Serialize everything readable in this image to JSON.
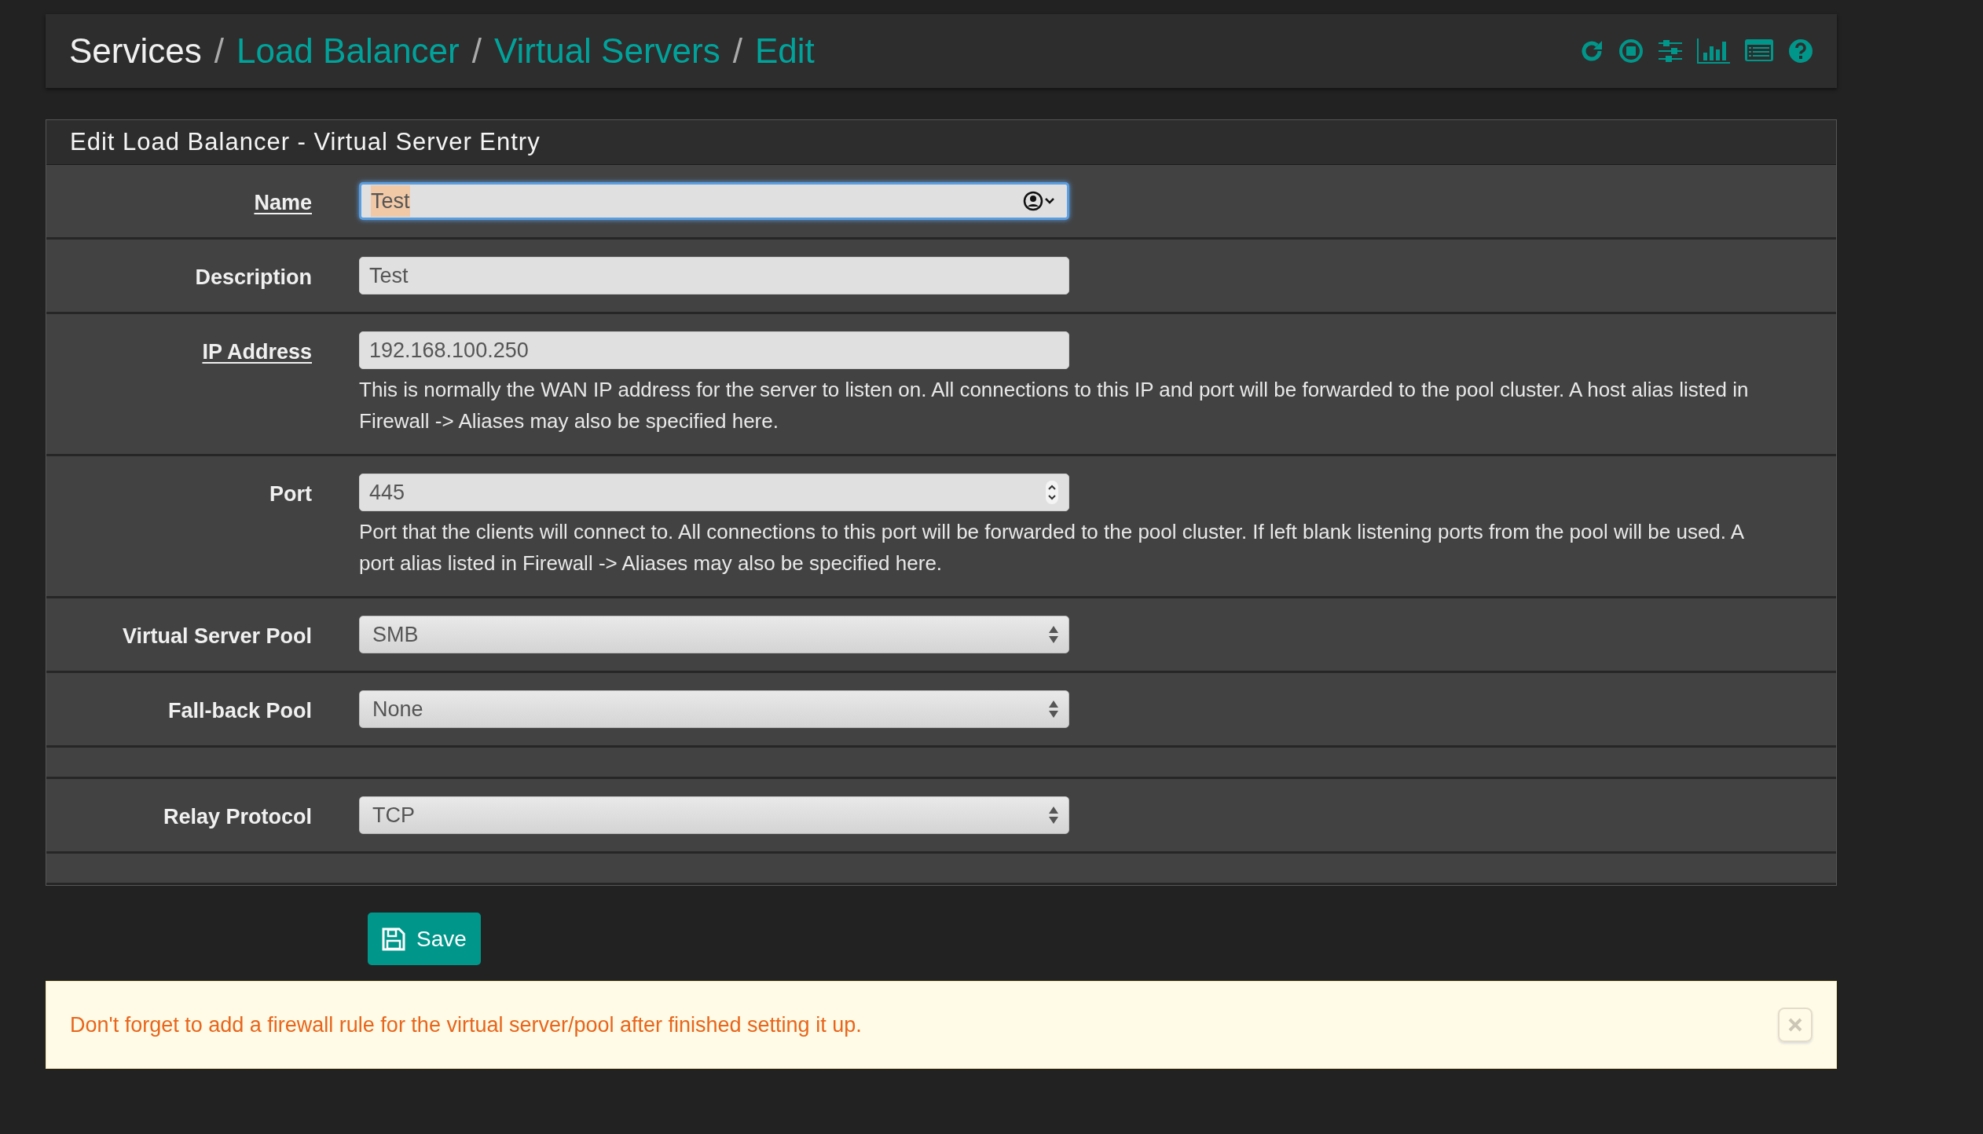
{
  "breadcrumb": [
    {
      "label": "Services",
      "kind": "plain",
      "separator": "/"
    },
    {
      "label": "Load Balancer",
      "kind": "link",
      "separator": "/"
    },
    {
      "label": "Virtual Servers",
      "kind": "link",
      "separator": "/"
    },
    {
      "label": "Edit",
      "kind": "link"
    }
  ],
  "panel": {
    "title": "Edit Load Balancer - Virtual Server Entry",
    "rows": [
      {
        "kind": "text",
        "label": "Name",
        "required": true,
        "value": "Test",
        "focused": true
      },
      {
        "kind": "text",
        "label": "Description",
        "required": false,
        "value": "Test",
        "focused": false
      },
      {
        "kind": "text",
        "label": "IP Address",
        "required": true,
        "value": "192.168.100.250",
        "focused": false,
        "help": "This is normally the WAN IP address for the server to listen on. All connections to this IP and port will be forwarded to the pool cluster. A host alias listed in Firewall -> Aliases may also be specified here."
      },
      {
        "kind": "number",
        "label": "Port",
        "required": false,
        "value": "445",
        "focused": false,
        "help": "Port that the clients will connect to. All connections to this port will be forwarded to the pool cluster. If left blank listening ports from the pool will be used. A port alias listed in Firewall -> Aliases may also be specified here."
      },
      {
        "kind": "select",
        "label": "Virtual Server Pool",
        "required": false,
        "value": "SMB"
      },
      {
        "kind": "select",
        "label": "Fall-back Pool",
        "required": false,
        "value": "None"
      },
      {
        "kind": "spacer"
      },
      {
        "kind": "select",
        "label": "Relay Protocol",
        "required": false,
        "value": "TCP"
      },
      {
        "kind": "spacer"
      }
    ]
  },
  "save_button": "Save",
  "alert": {
    "text": "Don't forget to add a firewall rule for the virtual server/pool after finished setting it up.",
    "dismissible": true
  }
}
